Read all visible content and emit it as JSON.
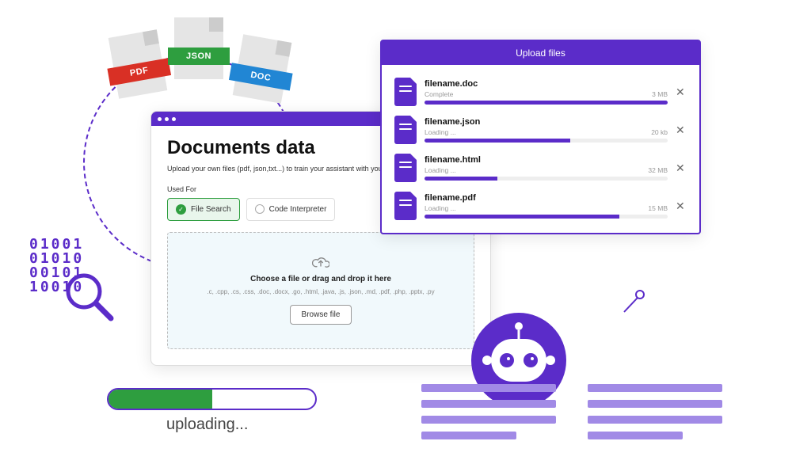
{
  "colors": {
    "primary": "#5b2cc9",
    "green": "#2e9e3f",
    "pdf": "#d93025",
    "doc": "#2186d4"
  },
  "file_cards": {
    "pdf": "PDF",
    "json": "JSON",
    "doc": "DOC"
  },
  "main_window": {
    "title": "Documents data",
    "subtitle": "Upload your own files (pdf, json,txt...) to train your assistant with your files.",
    "used_for_label": "Used For",
    "options": {
      "file_search": "File Search",
      "code_interpreter": "Code Interpreter"
    },
    "dropzone": {
      "title": "Choose a file or drag and drop it here",
      "subtitle": ".c, .cpp, .cs, .css, .doc, .docx, .go, .html, .java, .js, .json, .md, .pdf, .php, .pptx, .py",
      "browse_label": "Browse file"
    }
  },
  "upload_window": {
    "title": "Upload files",
    "files": [
      {
        "name": "filename.doc",
        "status": "Complete",
        "size": "3 MB",
        "progress": 100
      },
      {
        "name": "filename.json",
        "status": "Loading ...",
        "size": "20 kb",
        "progress": 60
      },
      {
        "name": "filename.html",
        "status": "Loading ...",
        "size": "32 MB",
        "progress": 30
      },
      {
        "name": "filename.pdf",
        "status": "Loading ...",
        "size": "15 MB",
        "progress": 80
      }
    ]
  },
  "binary_text": "01001\n01010\n00101\n10010",
  "uploading": {
    "label": "uploading...",
    "progress": 50
  }
}
